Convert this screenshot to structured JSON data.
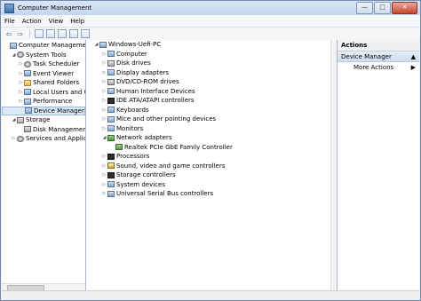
{
  "window": {
    "title": "Computer Management"
  },
  "window_controls": {
    "minimize": "—",
    "maximize": "□",
    "close": "✕"
  },
  "menu": [
    "File",
    "Action",
    "View",
    "Help"
  ],
  "toolbar": {
    "icons": [
      "back-arrow-icon",
      "forward-arrow-icon",
      "up-folder-icon",
      "show-hide-tree-icon",
      "properties-icon",
      "help-icon",
      "console-icon"
    ],
    "back": "⇦",
    "forward": "⇨"
  },
  "left_tree": [
    {
      "label": "Computer Management",
      "indent": 0,
      "exp": "",
      "icon": "computer"
    },
    {
      "label": "System Tools",
      "indent": 1,
      "exp": "◢",
      "icon": "gear"
    },
    {
      "label": "Task Scheduler",
      "indent": 2,
      "exp": "▷",
      "icon": "clock"
    },
    {
      "label": "Event Viewer",
      "indent": 2,
      "exp": "▷",
      "icon": "viewer"
    },
    {
      "label": "Shared Folders",
      "indent": 2,
      "exp": "▷",
      "icon": "folder"
    },
    {
      "label": "Local Users and Gr",
      "indent": 2,
      "exp": "▷",
      "icon": "users"
    },
    {
      "label": "Performance",
      "indent": 2,
      "exp": "▷",
      "icon": "chart"
    },
    {
      "label": "Device Manager",
      "indent": 2,
      "exp": "",
      "icon": "device",
      "selected": true
    },
    {
      "label": "Storage",
      "indent": 1,
      "exp": "◢",
      "icon": "disk"
    },
    {
      "label": "Disk Management",
      "indent": 2,
      "exp": "",
      "icon": "disk"
    },
    {
      "label": "Services and Applicat",
      "indent": 1,
      "exp": "▷",
      "icon": "gear"
    }
  ],
  "device_tree": [
    {
      "label": "Windows-Uefi-PC",
      "indent": 0,
      "exp": "◢",
      "icon": "computer"
    },
    {
      "label": "Computer",
      "indent": 1,
      "exp": "▷",
      "icon": "computer"
    },
    {
      "label": "Disk drives",
      "indent": 1,
      "exp": "▷",
      "icon": "disk"
    },
    {
      "label": "Display adapters",
      "indent": 1,
      "exp": "▷",
      "icon": "monitor"
    },
    {
      "label": "DVD/CD-ROM drives",
      "indent": 1,
      "exp": "▷",
      "icon": "disk"
    },
    {
      "label": "Human Interface Devices",
      "indent": 1,
      "exp": "▷",
      "icon": "hid"
    },
    {
      "label": "IDE ATA/ATAPI controllers",
      "indent": 1,
      "exp": "▷",
      "icon": "chip"
    },
    {
      "label": "Keyboards",
      "indent": 1,
      "exp": "▷",
      "icon": "keyboard"
    },
    {
      "label": "Mice and other pointing devices",
      "indent": 1,
      "exp": "▷",
      "icon": "mouse"
    },
    {
      "label": "Monitors",
      "indent": 1,
      "exp": "▷",
      "icon": "monitor"
    },
    {
      "label": "Network adapters",
      "indent": 1,
      "exp": "◢",
      "icon": "net"
    },
    {
      "label": "Realtek PCIe GbE Family Controller",
      "indent": 2,
      "exp": "",
      "icon": "net"
    },
    {
      "label": "Processors",
      "indent": 1,
      "exp": "▷",
      "icon": "chip"
    },
    {
      "label": "Sound, video and game controllers",
      "indent": 1,
      "exp": "▷",
      "icon": "snd"
    },
    {
      "label": "Storage controllers",
      "indent": 1,
      "exp": "▷",
      "icon": "chip"
    },
    {
      "label": "System devices",
      "indent": 1,
      "exp": "▷",
      "icon": "computer"
    },
    {
      "label": "Universal Serial Bus controllers",
      "indent": 1,
      "exp": "▷",
      "icon": "usb"
    }
  ],
  "actions": {
    "header": "Actions",
    "section": "Device Manager",
    "section_arrow": "▲",
    "items": [
      {
        "label": "More Actions",
        "arrow": "▶"
      }
    ]
  }
}
